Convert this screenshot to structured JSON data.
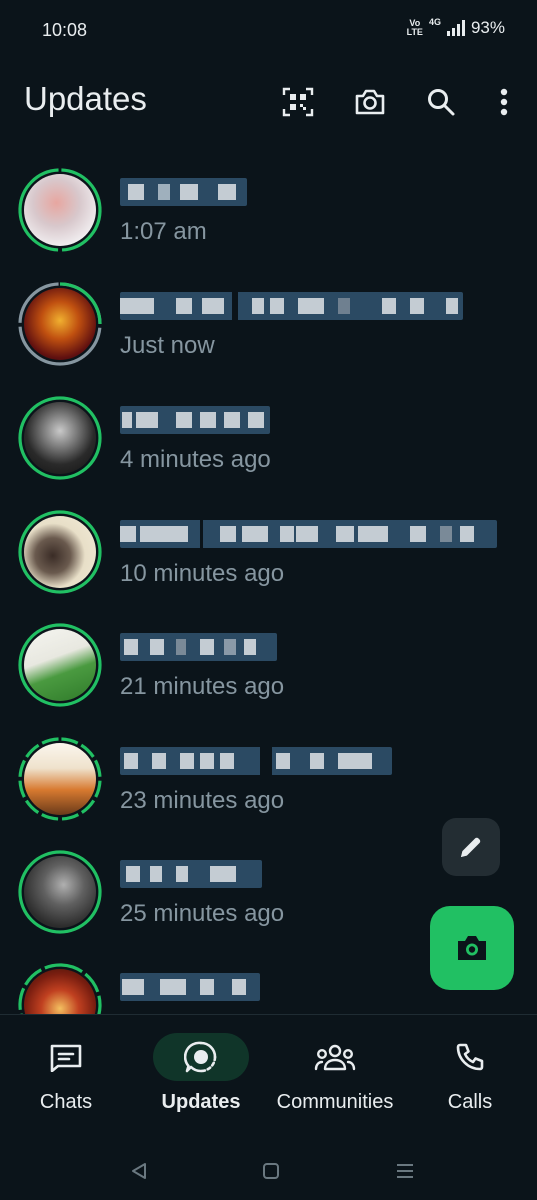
{
  "status_bar": {
    "time": "10:08",
    "volte_top": "Vo",
    "volte_bottom": "LTE",
    "network": "4G",
    "battery": "93%"
  },
  "header": {
    "title": "Updates",
    "icons": [
      "qr-scan-icon",
      "camera-icon",
      "search-icon",
      "more-vert-icon"
    ]
  },
  "statuses": [
    {
      "name": "",
      "time": "1:07 am",
      "ring": "unseen"
    },
    {
      "name": "",
      "time": "Just now",
      "ring": "partially-seen"
    },
    {
      "name": "",
      "time": "4 minutes ago",
      "ring": "unseen"
    },
    {
      "name": "",
      "time": "10 minutes ago",
      "ring": "unseen"
    },
    {
      "name": "",
      "time": "21 minutes ago",
      "ring": "unseen"
    },
    {
      "name": "",
      "time": "23 minutes ago",
      "ring": "unseen-segmented"
    },
    {
      "name": "",
      "time": "25 minutes ago",
      "ring": "unseen"
    },
    {
      "name": "",
      "time": "",
      "ring": "unseen-segmented"
    }
  ],
  "fabs": {
    "pencil_icon": "pencil-icon",
    "camera_icon": "camera-icon"
  },
  "bottom_nav": {
    "items": [
      {
        "label": "Chats",
        "icon": "chats-icon",
        "active": false
      },
      {
        "label": "Updates",
        "icon": "updates-icon",
        "active": true
      },
      {
        "label": "Communities",
        "icon": "communities-icon",
        "active": false
      },
      {
        "label": "Calls",
        "icon": "calls-icon",
        "active": false
      }
    ]
  },
  "colors": {
    "background": "#0b141a",
    "accent_green": "#21c063",
    "ring_seen": "#8696a0",
    "secondary_text": "#8696a0",
    "active_nav_bg": "#103529"
  }
}
